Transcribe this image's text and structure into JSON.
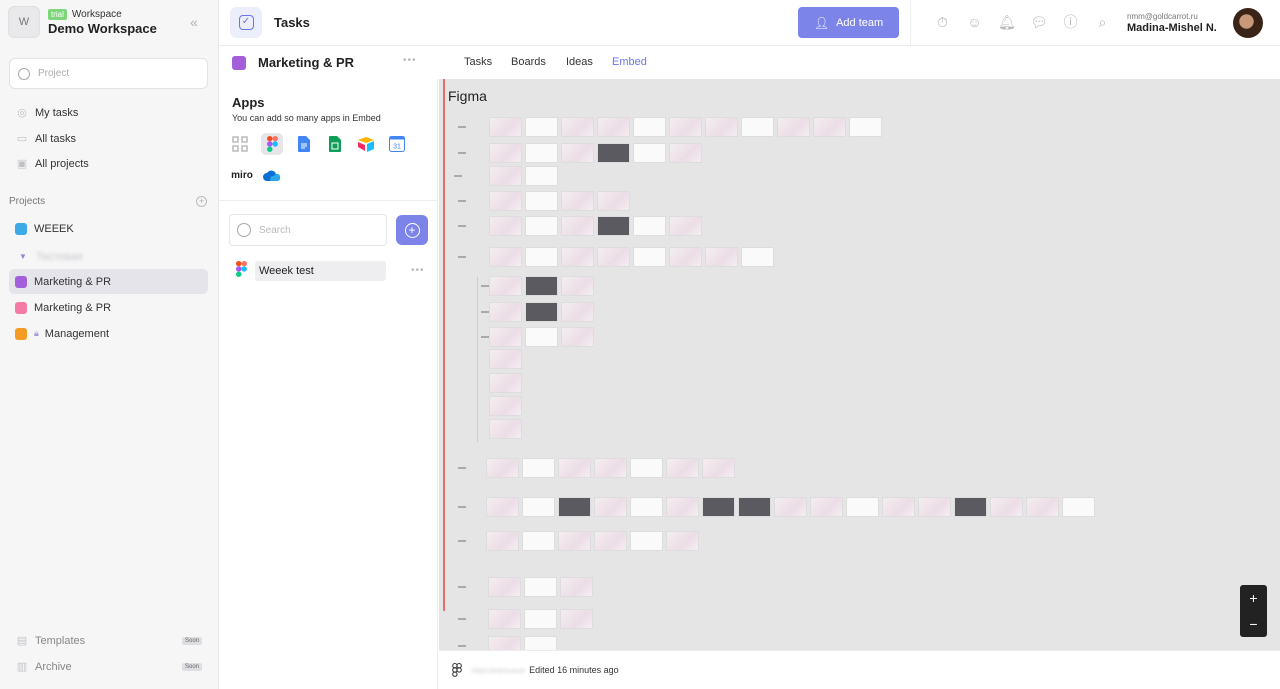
{
  "workspace": {
    "avatar_letter": "W",
    "trial_badge": "trial",
    "label": "Workspace",
    "name": "Demo Workspace"
  },
  "sidebar": {
    "search_placeholder": "Project",
    "nav": [
      {
        "label": "My tasks",
        "icon": "check-circle-icon"
      },
      {
        "label": "All tasks",
        "icon": "tray-icon"
      },
      {
        "label": "All projects",
        "icon": "briefcase-icon"
      }
    ],
    "projects_header": "Projects",
    "projects": [
      {
        "label": "WEEEK",
        "color": "#3da9e6"
      },
      {
        "label": "Тестовая",
        "color": ""
      },
      {
        "label": "Marketing & PR",
        "color": "#a35fd9"
      },
      {
        "label": "Marketing & PR",
        "color": "#f57aa5"
      },
      {
        "label": "Management",
        "color": "#f59a23"
      }
    ],
    "footer": [
      {
        "label": "Templates",
        "badge": "Soon"
      },
      {
        "label": "Archive",
        "badge": "Soon"
      }
    ]
  },
  "topbar": {
    "title": "Tasks",
    "add_team_label": "Add team",
    "user_email": "nmm@goldcarrot.ru",
    "user_name": "Madina-Mishel N."
  },
  "subheader": {
    "project_title": "Marketing & PR",
    "project_color": "#a35fd9",
    "tabs": [
      "Tasks",
      "Boards",
      "Ideas",
      "Embed"
    ],
    "active_tab": "Embed"
  },
  "apps": {
    "title": "Apps",
    "subtitle": "You can add so many apps in Embed",
    "miro_label": "miro",
    "calendar_label": "31"
  },
  "embeds": {
    "search_placeholder": "Search",
    "items": [
      {
        "name": "Weeek test"
      }
    ]
  },
  "embed_view": {
    "title": "Figma",
    "editor": "персональные",
    "edited": "Edited 16 minutes ago"
  }
}
